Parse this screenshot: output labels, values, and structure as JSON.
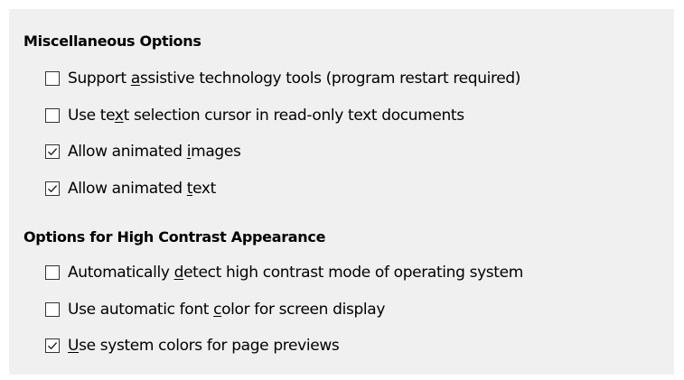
{
  "sections": [
    {
      "title": "Miscellaneous Options",
      "options": [
        {
          "pre": "Support ",
          "key": "a",
          "post": "ssistive technology tools (program restart required)",
          "checked": false
        },
        {
          "pre": "Use te",
          "key": "x",
          "post": "t selection cursor in read-only text documents",
          "checked": false
        },
        {
          "pre": "Allow animated ",
          "key": "i",
          "post": "mages",
          "checked": true
        },
        {
          "pre": "Allow animated ",
          "key": "t",
          "post": "ext",
          "checked": true
        }
      ]
    },
    {
      "title": "Options for High Contrast Appearance",
      "options": [
        {
          "pre": "Automatically ",
          "key": "d",
          "post": "etect high contrast mode of operating system",
          "checked": false
        },
        {
          "pre": "Use automatic font ",
          "key": "c",
          "post": "olor for screen display",
          "checked": false
        },
        {
          "pre": "",
          "key": "U",
          "post": "se system colors for page previews",
          "checked": true
        }
      ]
    }
  ],
  "icons": {
    "checkmark": "check-icon"
  },
  "colors": {
    "panel_background": "#f0f0f0",
    "checkbox_border": "#333333",
    "checkbox_fill": "#ffffff"
  }
}
